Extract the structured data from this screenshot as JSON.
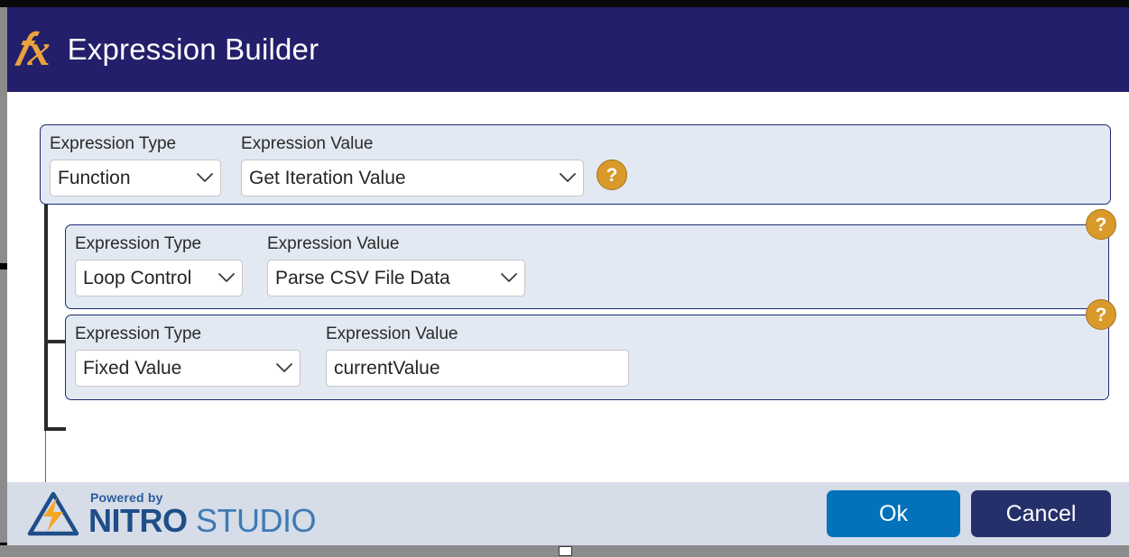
{
  "window": {
    "title": "Expression Builder",
    "fx_icon": "fx-icon",
    "header_bg": "#231f6b",
    "fx_color": "#e8a33d"
  },
  "labels": {
    "expression_type": "Expression Type",
    "expression_value": "Expression Value",
    "help": "?"
  },
  "rows": [
    {
      "type_value": "Function",
      "value_value": "Get Iteration Value",
      "value_kind": "select",
      "help_label": "?"
    },
    {
      "type_value": "Loop Control",
      "value_value": "Parse CSV File Data",
      "value_kind": "select",
      "help_label": "?"
    },
    {
      "type_value": "Fixed Value",
      "value_value": "currentValue",
      "value_kind": "text",
      "help_label": "?"
    }
  ],
  "footer": {
    "powered_by": "Powered by",
    "brand_primary": "NITRO",
    "brand_secondary": "STUDIO",
    "ok_label": "Ok",
    "cancel_label": "Cancel",
    "ok_color": "#0472bb",
    "cancel_color": "#25306b"
  }
}
